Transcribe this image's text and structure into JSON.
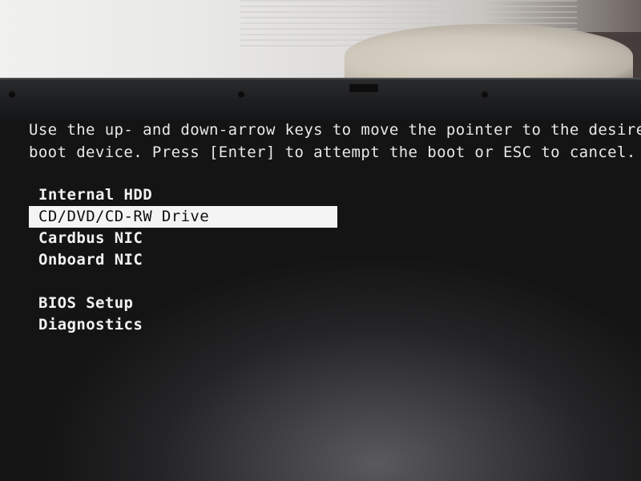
{
  "instructions": {
    "line1": "Use the up- and down-arrow keys to move the pointer to the desired",
    "line2": "boot device. Press [Enter] to attempt the boot or ESC to cancel."
  },
  "boot_menu": {
    "devices": [
      {
        "label": "Internal HDD",
        "selected": false
      },
      {
        "label": "CD/DVD/CD-RW Drive",
        "selected": true
      },
      {
        "label": "Cardbus NIC",
        "selected": false
      },
      {
        "label": "Onboard NIC",
        "selected": false
      }
    ],
    "utilities": [
      {
        "label": "BIOS Setup"
      },
      {
        "label": "Diagnostics"
      }
    ]
  },
  "colors": {
    "screen_text": "#e8e8e8",
    "highlight_bg": "#f4f4f4",
    "highlight_text": "#0f0f0f"
  }
}
